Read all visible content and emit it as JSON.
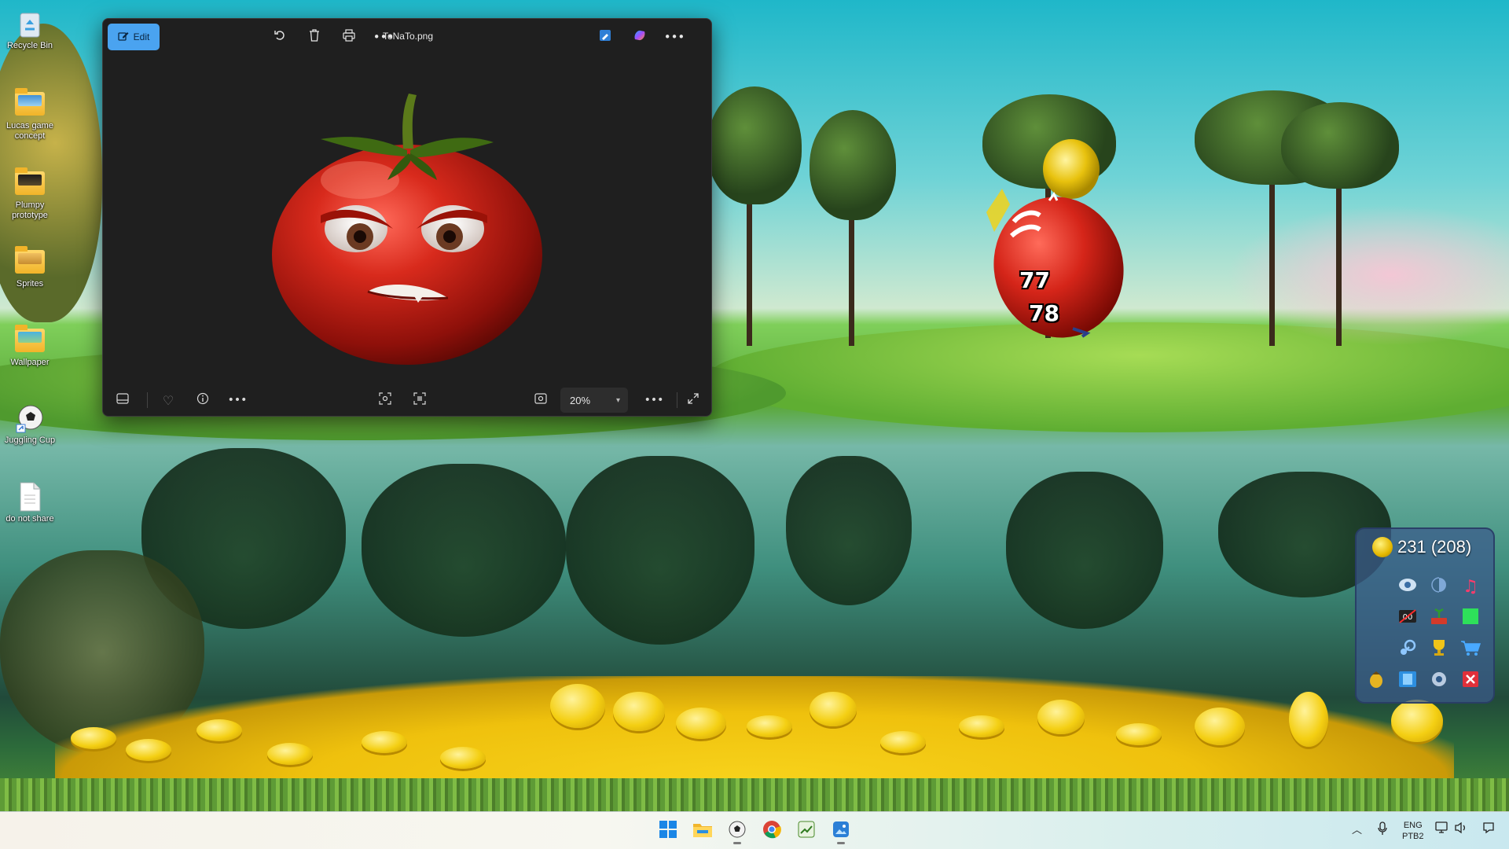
{
  "desktop": {
    "icons": [
      {
        "label": "Recycle Bin"
      },
      {
        "label": "Lucas game concept"
      },
      {
        "label": "Plumpy prototype"
      },
      {
        "label": "Sprites"
      },
      {
        "label": "Wallpaper"
      },
      {
        "label": "Juggling Cup"
      },
      {
        "label": "do not share"
      }
    ]
  },
  "photos_window": {
    "title": "ToNaTo.png",
    "edit_label": "Edit",
    "zoom": "20%",
    "icons": {
      "edit": "edit-icon",
      "rotate": "rotate-icon",
      "delete": "trash-icon",
      "print": "print-icon",
      "more": "more-icon",
      "edit_image": "image-edit-icon",
      "copilot": "copilot-icon",
      "filmstrip": "filmstrip-icon",
      "favorite": "heart-icon",
      "info": "info-icon",
      "crop": "crop-icon",
      "scan": "scan-text-icon",
      "fit": "fit-icon",
      "fullscreen": "expand-icon"
    }
  },
  "game": {
    "score_top": "77",
    "score_bottom": "78",
    "coin_display": "231 (208)"
  },
  "taskbar": {
    "lang_top": "ENG",
    "lang_bottom": "PTB2"
  }
}
